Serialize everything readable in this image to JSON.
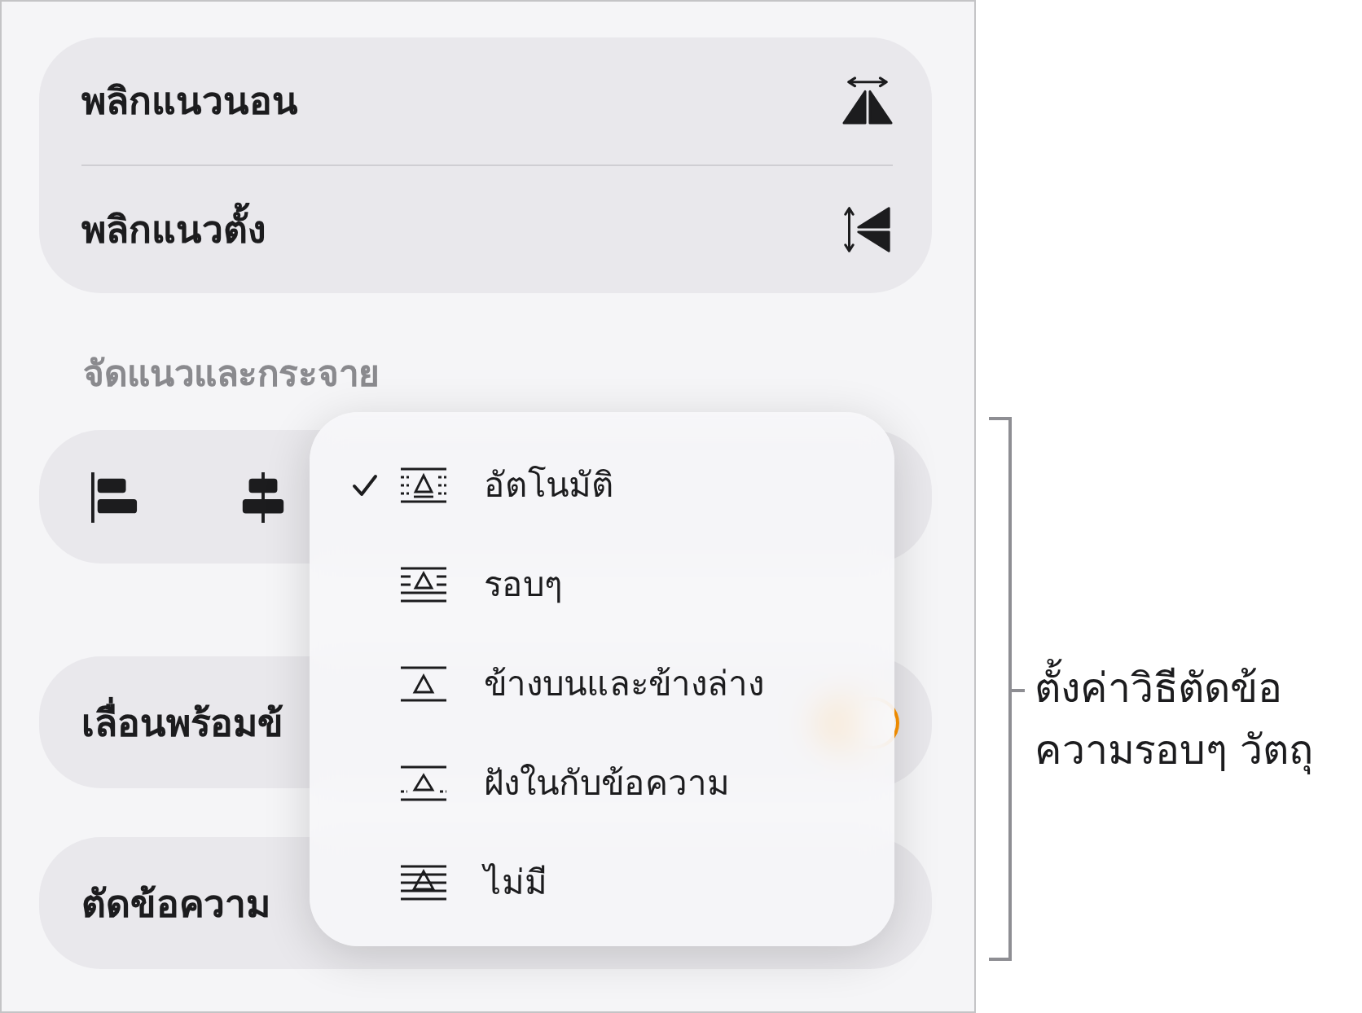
{
  "flip": {
    "rows": [
      {
        "label": "พลิกแนวนอน",
        "kind": "horizontal"
      },
      {
        "label": "พลิกแนวตั้ง",
        "kind": "vertical"
      }
    ]
  },
  "align_section": {
    "header": "จัดแนวและกระจาย",
    "buttons": [
      {
        "kind": "left"
      },
      {
        "kind": "center"
      }
    ]
  },
  "move_with_text": {
    "label": "เลื่อนพร้อมข้",
    "on": true
  },
  "text_wrap": {
    "label": "ตัดข้อความ"
  },
  "wrap_menu": {
    "items": [
      {
        "label": "อัตโนมัติ",
        "kind": "auto",
        "selected": true
      },
      {
        "label": "รอบๆ",
        "kind": "around",
        "selected": false
      },
      {
        "label": "ข้างบนและข้างล่าง",
        "kind": "topbottom",
        "selected": false
      },
      {
        "label": "ฝังในกับข้อความ",
        "kind": "inline",
        "selected": false
      },
      {
        "label": "ไม่มี",
        "kind": "none",
        "selected": false
      }
    ]
  },
  "annotation": {
    "lines": [
      "ตั้งค่าวิธีตัดข้อ",
      "ความรอบๆ วัตถุ"
    ]
  }
}
